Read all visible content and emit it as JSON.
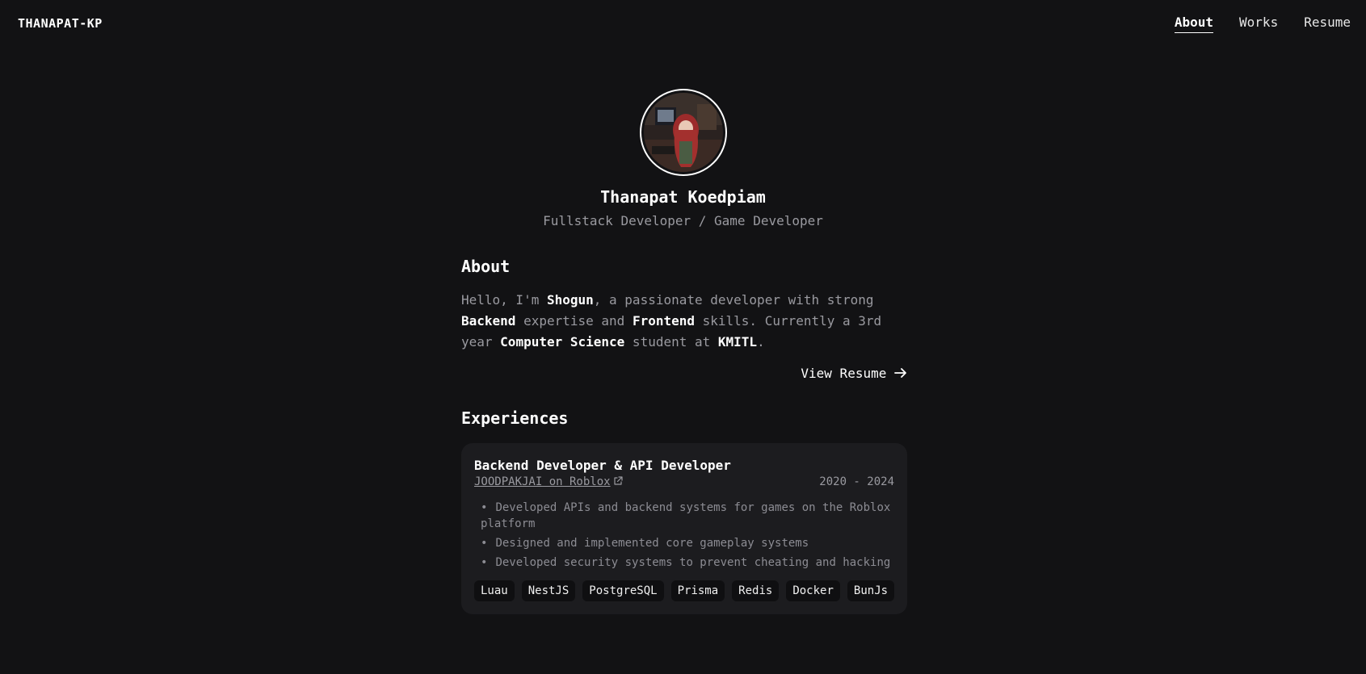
{
  "header": {
    "brand": "THANAPAT-KP",
    "nav": [
      {
        "label": "About",
        "active": true
      },
      {
        "label": "Works",
        "active": false
      },
      {
        "label": "Resume",
        "active": false
      }
    ]
  },
  "profile": {
    "name": "Thanapat Koedpiam",
    "role": "Fullstack Developer / Game Developer"
  },
  "about": {
    "heading": "About",
    "p1": "Hello, I'm ",
    "nick": "Shogun",
    "p2": ", a passionate developer with strong ",
    "backend": "Backend",
    "p3": " expertise and ",
    "frontend": "Frontend",
    "p4": " skills. Currently a 3rd year ",
    "cs": "Computer Science",
    "p5": " student at ",
    "school": "KMITL",
    "p6": ".",
    "cta": "View Resume",
    "cta_icon": "arrow-right-icon"
  },
  "experiences": {
    "heading": "Experiences",
    "items": [
      {
        "title": "Backend Developer & API Developer",
        "company": "JOODPAKJAI on Roblox",
        "link_icon": "external-link-icon",
        "period": "2020 - 2024",
        "bullets": [
          "Developed APIs and backend systems for games on the Roblox platform",
          "Designed and implemented core gameplay systems",
          "Developed security systems to prevent cheating and hacking"
        ],
        "tags": [
          "Luau",
          "NestJS",
          "PostgreSQL",
          "Prisma",
          "Redis",
          "Docker",
          "BunJs"
        ]
      }
    ]
  },
  "colors": {
    "background": "#121214",
    "card": "#1c1c1f",
    "muted_text": "#9a9aa0",
    "text": "#ffffff"
  }
}
